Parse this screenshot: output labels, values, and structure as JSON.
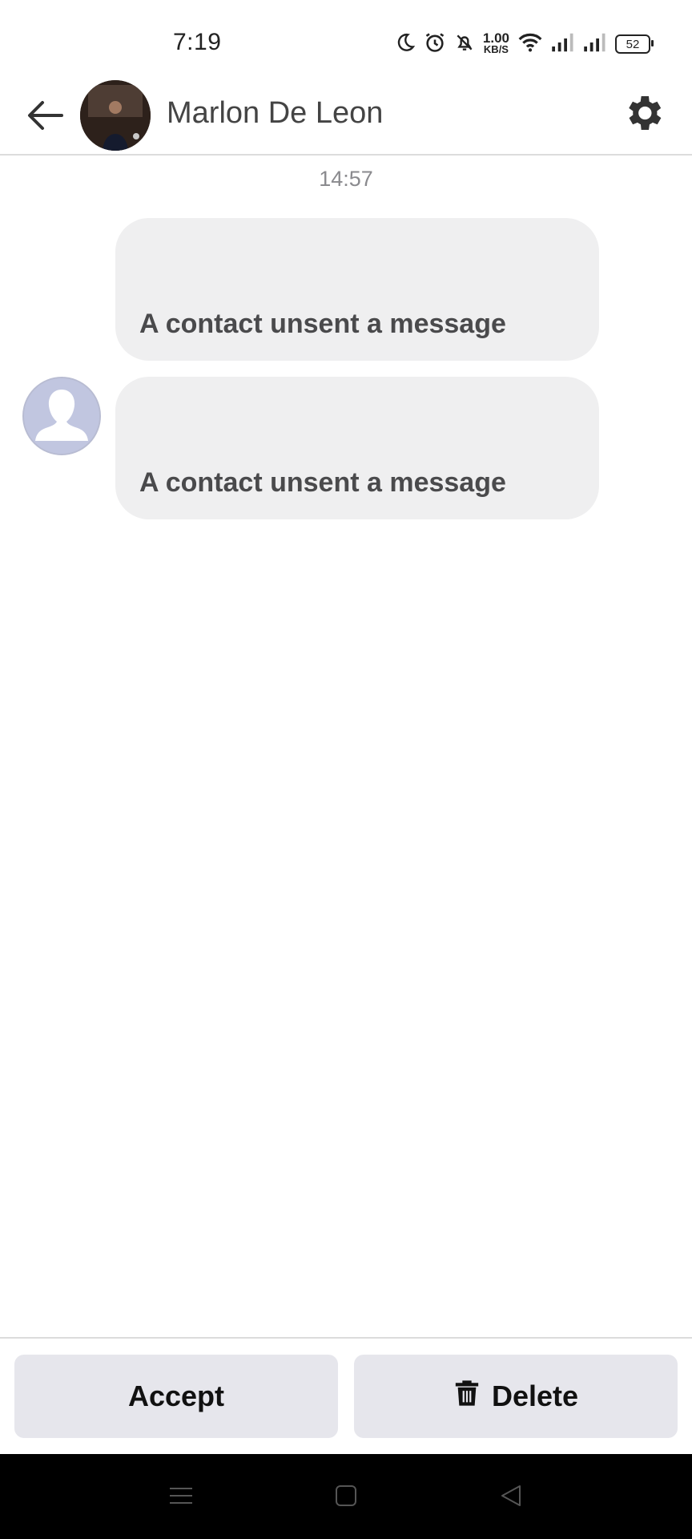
{
  "status_bar": {
    "time": "7:19",
    "net_speed_value": "1.00",
    "net_speed_unit": "KB/S",
    "battery": "52",
    "icons": [
      "moon-icon",
      "alarm-icon",
      "bell-off-icon",
      "wifi-icon",
      "signal-icon",
      "signal-icon",
      "battery-icon"
    ]
  },
  "header": {
    "contact_name": "Marlon De Leon",
    "back_icon": "arrow-left-icon",
    "settings_icon": "gear-icon"
  },
  "chat": {
    "timestamp": "14:57",
    "messages": [
      {
        "text": "A contact unsent a message"
      },
      {
        "text": "A contact unsent a message"
      }
    ]
  },
  "actions": {
    "accept_label": "Accept",
    "delete_label": "Delete",
    "delete_icon": "trash-icon"
  },
  "nav_bar": {
    "icons": [
      "menu-icon",
      "home-icon",
      "back-triangle-icon"
    ]
  },
  "colors": {
    "bubble": "#efeff0",
    "button": "#e6e6ec",
    "divider": "#dcdcdc"
  }
}
